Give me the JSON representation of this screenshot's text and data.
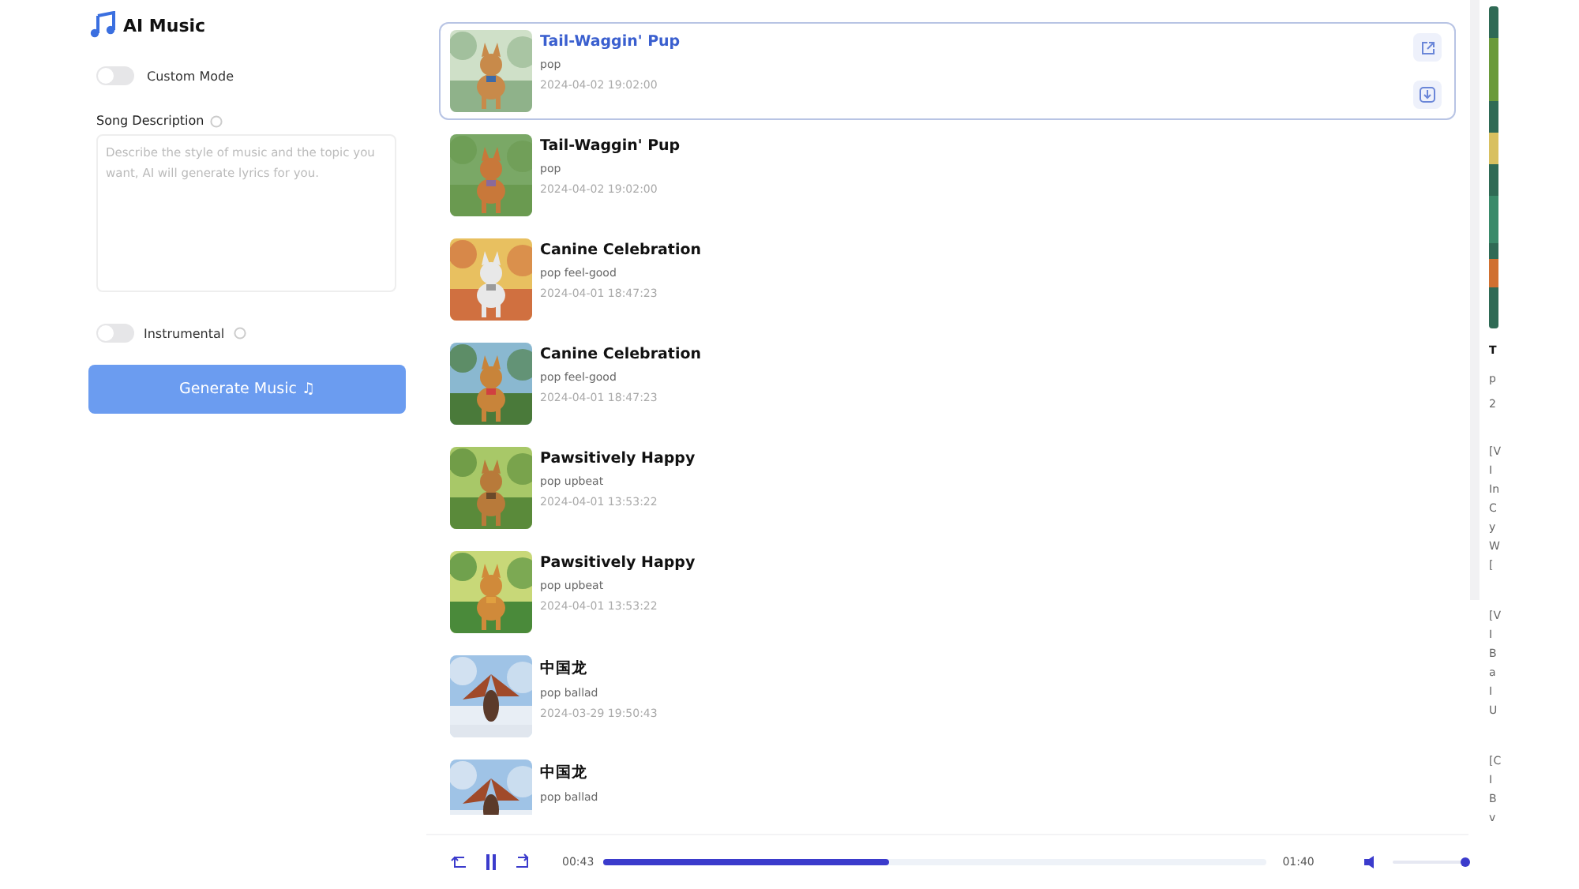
{
  "app": {
    "title": "AI Music"
  },
  "form": {
    "custom_mode": {
      "label": "Custom Mode",
      "on": false
    },
    "description": {
      "label": "Song Description",
      "placeholder": "Describe the style of music and the topic you want, AI will generate lyrics for you."
    },
    "instrumental": {
      "label": "Instrumental",
      "on": false
    },
    "generate_button": "Generate Music ♫"
  },
  "songs": [
    {
      "title": "Tail-Waggin' Pup",
      "tags": "pop",
      "date": "2024-04-02 19:02:00",
      "selected": true
    },
    {
      "title": "Tail-Waggin' Pup",
      "tags": "pop",
      "date": "2024-04-02 19:02:00",
      "selected": false
    },
    {
      "title": "Canine Celebration",
      "tags": "pop feel-good",
      "date": "2024-04-01 18:47:23",
      "selected": false
    },
    {
      "title": "Canine Celebration",
      "tags": "pop feel-good",
      "date": "2024-04-01 18:47:23",
      "selected": false
    },
    {
      "title": "Pawsitively Happy",
      "tags": "pop upbeat",
      "date": "2024-04-01 13:53:22",
      "selected": false
    },
    {
      "title": "Pawsitively Happy",
      "tags": "pop upbeat",
      "date": "2024-04-01 13:53:22",
      "selected": false
    },
    {
      "title": "中国龙",
      "tags": "pop ballad",
      "date": "2024-03-29 19:50:43",
      "selected": false
    },
    {
      "title": "中国龙",
      "tags": "pop ballad",
      "selected": false
    }
  ],
  "detail": {
    "title": "T",
    "tags": "p",
    "date": "2",
    "lyrics": [
      [
        "[V",
        "I",
        "In",
        "C",
        "y",
        "W",
        "["
      ],
      [
        "[V",
        "I",
        "B",
        "a",
        "I",
        "U"
      ],
      [
        "[C",
        "I",
        "B",
        "v"
      ]
    ]
  },
  "player": {
    "playing": true,
    "elapsed": "00:43",
    "total": "01:40",
    "level": 0.43,
    "volume": {
      "level": 1
    }
  }
}
